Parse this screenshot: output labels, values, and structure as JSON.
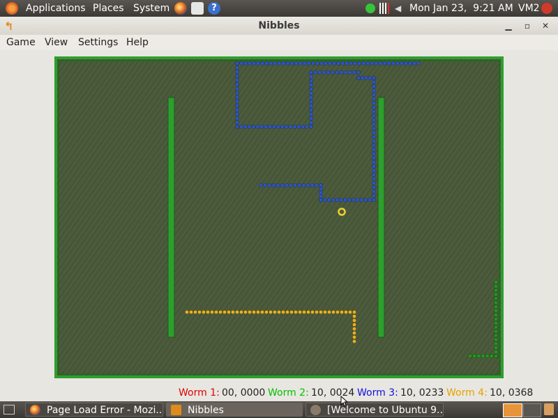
{
  "top_panel": {
    "menus": [
      "Applications",
      "Places",
      "System"
    ],
    "clock": "Mon Jan 23,  9:21 AM",
    "user": "VM2"
  },
  "window": {
    "title": "Nibbles",
    "menus": [
      "Game",
      "View",
      "Settings",
      "Help"
    ]
  },
  "status": {
    "worm1_label": "Worm 1:",
    "worm1_value": "00, 0000",
    "worm2_label": "Worm 2:",
    "worm2_value": "10, 0024",
    "worm3_label": "Worm 3:",
    "worm3_value": "10, 0233",
    "worm4_label": "Worm 4:",
    "worm4_value": "10, 0368",
    "colors": {
      "worm1": "#e00000",
      "worm2": "#00d000",
      "worm3": "#1010e0",
      "worm4": "#e8a000"
    }
  },
  "taskbar": {
    "tasks": [
      "Page Load Error - Mozi...",
      "Nibbles",
      "[Welcome to Ubuntu 9...."
    ]
  },
  "game_colors": {
    "field": "#4c5b3c",
    "wall": "#2e9e2e",
    "blue_worm": "#2c55c8",
    "yellow_worm": "#e8b020",
    "green_worm": "#1e9a1e"
  }
}
